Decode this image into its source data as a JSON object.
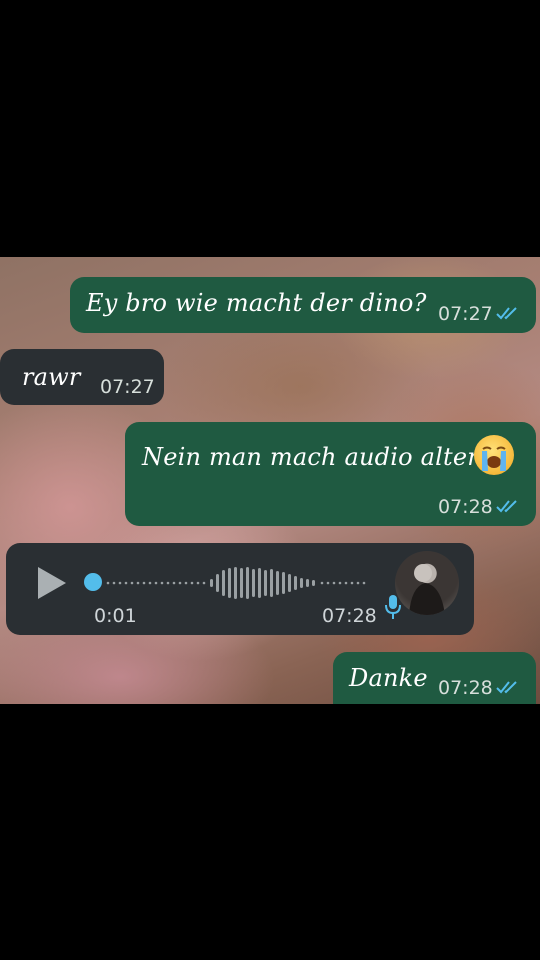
{
  "messages": [
    {
      "direction": "outgoing",
      "text": "Ey bro wie macht der dino?",
      "time": "07:27",
      "status": "read"
    },
    {
      "direction": "incoming",
      "text": "rawr",
      "time": "07:27"
    },
    {
      "direction": "outgoing",
      "text": "Nein man mach audio alter",
      "emoji": "crying-face",
      "time": "07:28",
      "status": "read"
    },
    {
      "direction": "incoming",
      "type": "voice",
      "duration": "0:01",
      "time": "07:28",
      "progress": 0.0
    },
    {
      "direction": "outgoing",
      "text": "Danke",
      "time": "07:28",
      "status": "read"
    }
  ],
  "colors": {
    "outgoing_bubble": "#1f5a41",
    "incoming_bubble": "#2a2f33",
    "read_ticks": "#53bdeb",
    "background": "#000000"
  },
  "icons": [
    "double-check-icon",
    "play-icon",
    "mic-icon",
    "avatar",
    "crying-face-emoji"
  ]
}
